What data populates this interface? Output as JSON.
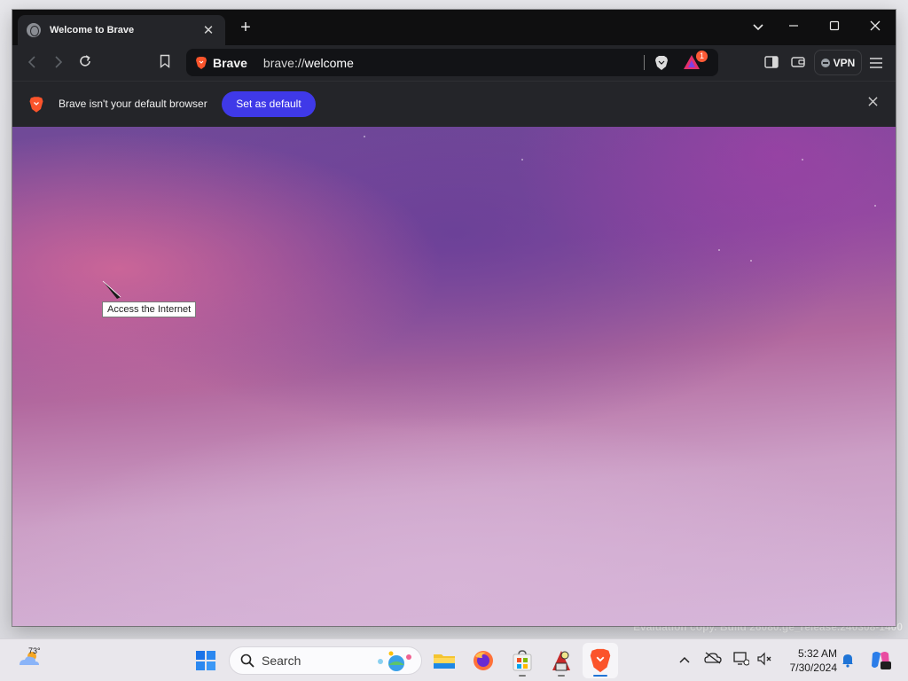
{
  "browser": {
    "tab": {
      "title": "Welcome to Brave",
      "close_label": "✕"
    },
    "new_tab_label": "+",
    "window_controls": {
      "tab_search": "⌄",
      "minimize": "—",
      "maximize": "☐",
      "close": "✕"
    },
    "toolbar": {
      "back": "‹",
      "forward": "›",
      "reload": "↻",
      "bookmark_icon": "bookmark-icon",
      "omnibox": {
        "brand": "Brave",
        "url_prefix": "brave://",
        "url_host": "welcome"
      },
      "rewards_badge": "1",
      "vpn_label": "VPN",
      "menu": "≡"
    },
    "infobar": {
      "message": "Brave isn't your default browser",
      "button_label": "Set as default",
      "close_label": "✕"
    },
    "content": {
      "tooltip": "Access the Internet"
    }
  },
  "desktop": {
    "watermark": "Evaluation copy. Build 26080.ge_release.240308-1400"
  },
  "taskbar": {
    "weather_temp": "73°",
    "search_label": "Search",
    "clock": {
      "time": "5:32 AM",
      "date": "7/30/2024"
    },
    "tray": {
      "chevron": "^"
    }
  },
  "colors": {
    "accent_button": "#3f39e8",
    "brave_orange": "#fb542b",
    "badge": "#ff5a36"
  }
}
